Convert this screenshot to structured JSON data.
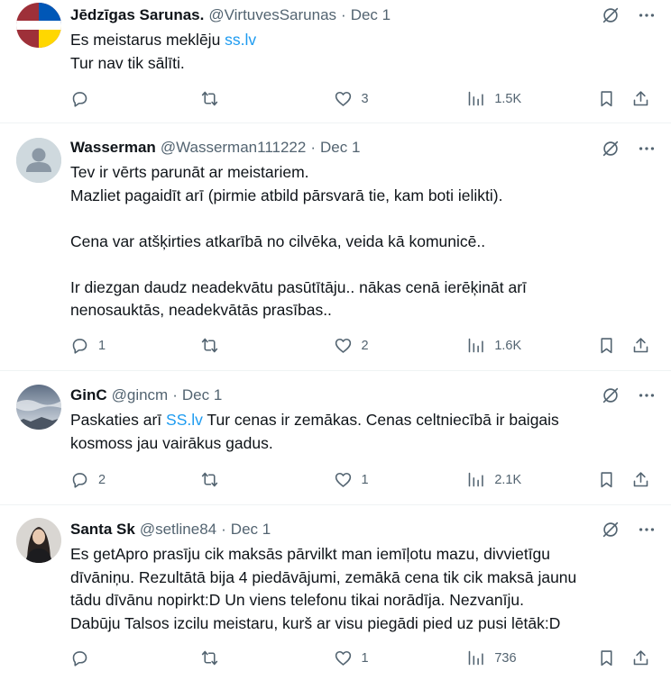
{
  "tweets": [
    {
      "name": "Jēdzīgas Sarunas.",
      "handle": "@VirtuvesSarunas",
      "dot": "·",
      "date": "Dec 1",
      "line1_prefix": "Es meistarus meklēju ",
      "line1_link": "ss.lv",
      "rest": "Tur nav tik sālīti.",
      "replies": "",
      "retweets": "",
      "likes": "3",
      "views": "1.5K"
    },
    {
      "name": "Wasserman",
      "handle": "@Wasserman111222",
      "dot": "·",
      "date": "Dec 1",
      "text": "Tev ir vērts parunāt ar meistariem.\nMazliet pagaidīt arī (pirmie atbild pārsvarā tie, kam boti ielikti).\n\nCena var atšķirties atkarībā no cilvēka, veida kā komunicē..\n\nIr diezgan daudz neadekvātu pasūtītāju.. nākas cenā ierēķināt arī\nnenosauktās, neadekvātās prasības..",
      "replies": "1",
      "retweets": "",
      "likes": "2",
      "views": "1.6K"
    },
    {
      "name": "GinC",
      "handle": "@gincm",
      "dot": "·",
      "date": "Dec 1",
      "line1_prefix": "Paskaties arī ",
      "line1_link": "SS.lv",
      "line1_suffix": " Tur cenas ir zemākas. Cenas celtniecībā ir baigais",
      "rest": "kosmoss jau vairākus gadus.",
      "replies": "2",
      "retweets": "",
      "likes": "1",
      "views": "2.1K"
    },
    {
      "name": "Santa Sk",
      "handle": "@setline84",
      "dot": "·",
      "date": "Dec 1",
      "text": "Es getApro prasīju cik maksās pārvilkt man iemīļotu mazu, divvietīgu\ndīvāniņu. Rezultātā bija 4 piedāvājumi, zemākā cena tik cik maksā jaunu\ntādu dīvānu nopirkt:D Un viens telefonu tikai norādīja. Nezvanīju.\nDabūju Talsos izcilu meistaru, kurš ar visu piegādi pied uz pusi lētāk:D",
      "replies": "",
      "retweets": "",
      "likes": "1",
      "views": "736"
    }
  ],
  "icons": {
    "grok": "grok-icon",
    "more": "more-icon",
    "reply": "reply-icon",
    "retweet": "retweet-icon",
    "like": "like-icon",
    "views": "views-icon",
    "bookmark": "bookmark-icon",
    "share": "share-icon"
  },
  "colors": {
    "link": "#1d9bf0",
    "secondary_text": "#536471",
    "divider": "#eff3f4",
    "flag_red": "#9e3039",
    "flag_white": "#ffffff",
    "flag_blue": "#0057b7",
    "flag_yellow": "#ffd700"
  }
}
